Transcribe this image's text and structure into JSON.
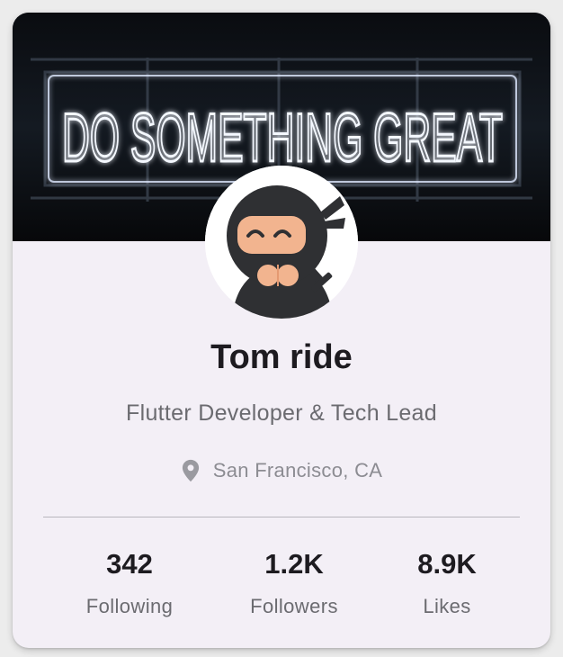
{
  "cover": {
    "neon_text": "DO SOMETHING GREAT"
  },
  "profile": {
    "name": "Tom ride",
    "title": "Flutter Developer & Tech Lead",
    "location": "San Francisco, CA"
  },
  "stats": [
    {
      "value": "342",
      "label": "Following"
    },
    {
      "value": "1.2K",
      "label": "Followers"
    },
    {
      "value": "8.9K",
      "label": "Likes"
    }
  ],
  "icons": {
    "location": "location-pin-icon"
  },
  "colors": {
    "card_background": "#f3eff6",
    "name_text": "#1d1b20",
    "secondary_text": "#6b6b70",
    "neon": "#eef4ff"
  }
}
